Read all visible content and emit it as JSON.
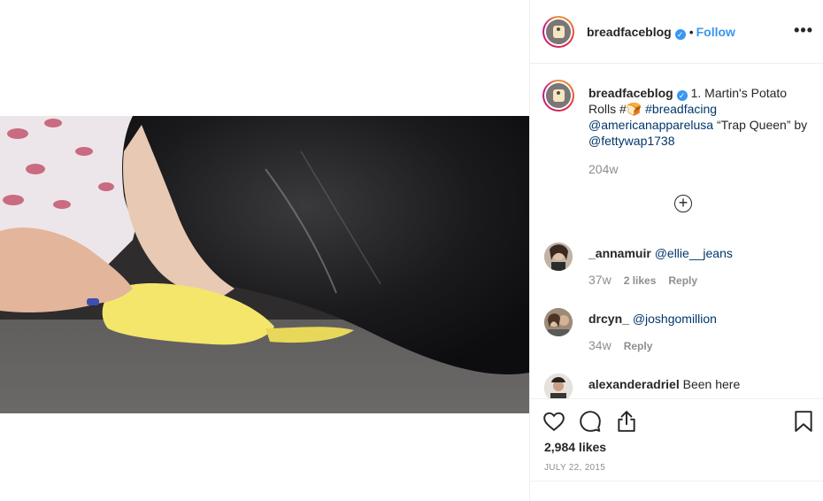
{
  "post": {
    "username": "breadfaceblog",
    "follow_label": "Follow",
    "dot": "•",
    "more_label": "•••",
    "caption": {
      "username": "breadfaceblog",
      "text_1": " 1. Martin's Potato Rolls #",
      "emoji": "🍞",
      "hashtag": " #breadfacing",
      "mention_1": "@americanapparelusa",
      "text_2": " “Trap Queen” by ",
      "mention_2": "@fettywap1738",
      "time": "204w"
    },
    "load_more_icon": "plus-circle-icon",
    "comments": [
      {
        "username": "_annamuir",
        "mention": "@ellie__jeans",
        "time": "37w",
        "likes": "2 likes",
        "reply": "Reply"
      },
      {
        "username": "drcyn_",
        "mention": "@joshgomillion",
        "time": "34w",
        "reply": "Reply"
      },
      {
        "username": "alexanderadriel",
        "text": "Been here"
      }
    ],
    "actions": {
      "like_icon": "heart-icon",
      "comment_icon": "comment-icon",
      "share_icon": "share-icon",
      "save_icon": "bookmark-icon"
    },
    "likes": "2,984 likes",
    "date": "JULY 22, 2015"
  },
  "colors": {
    "link": "#00376b",
    "follow": "#3897f0",
    "muted": "#8e8e8e",
    "border": "#efefef"
  }
}
